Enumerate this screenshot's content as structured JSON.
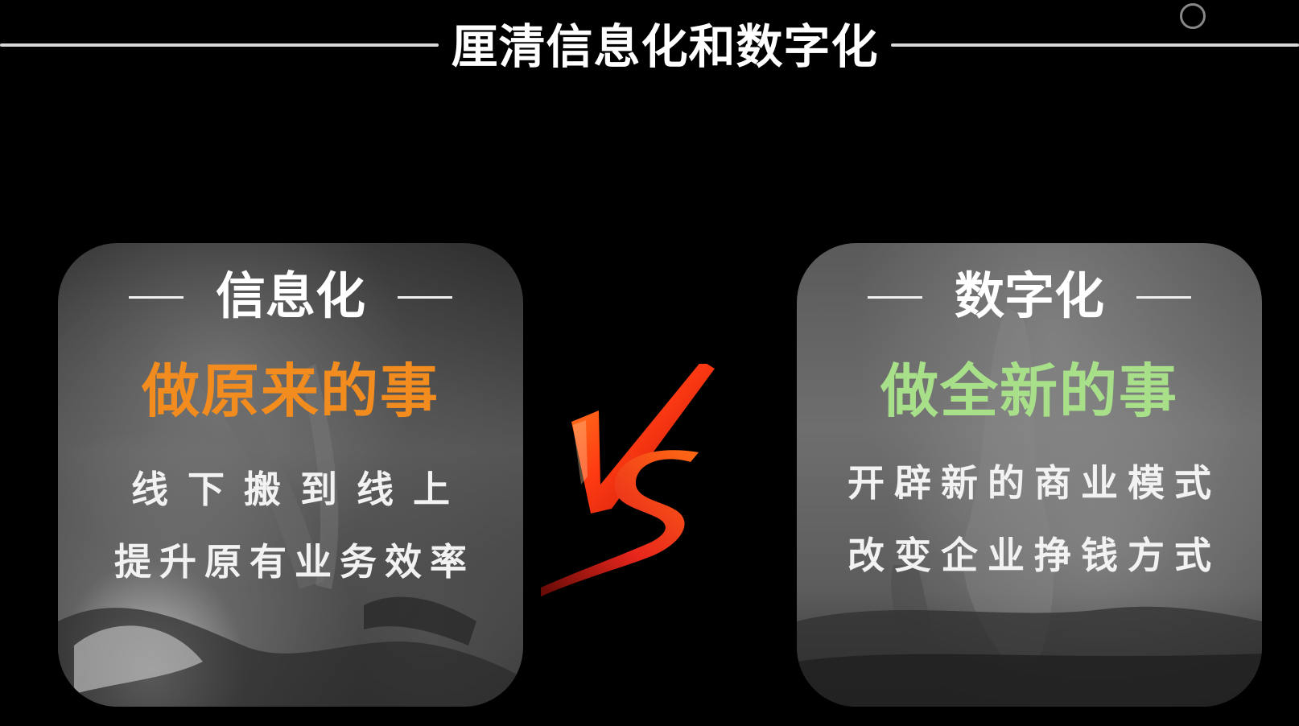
{
  "slide": {
    "title": "厘清信息化和数字化",
    "vs_label": "VS",
    "colors": {
      "background": "#000000",
      "left_accent": "#f28c1e",
      "right_accent": "#a8e08a",
      "vs_red": "#e8261c",
      "vs_orange": "#ff7a1a"
    },
    "left_card": {
      "heading": "信息化",
      "main": "做原来的事",
      "line1": "线下搬到线上",
      "line2": "提升原有业务效率"
    },
    "right_card": {
      "heading": "数字化",
      "main": "做全新的事",
      "line1": "开辟新的商业模式",
      "line2": "改变企业挣钱方式"
    }
  }
}
